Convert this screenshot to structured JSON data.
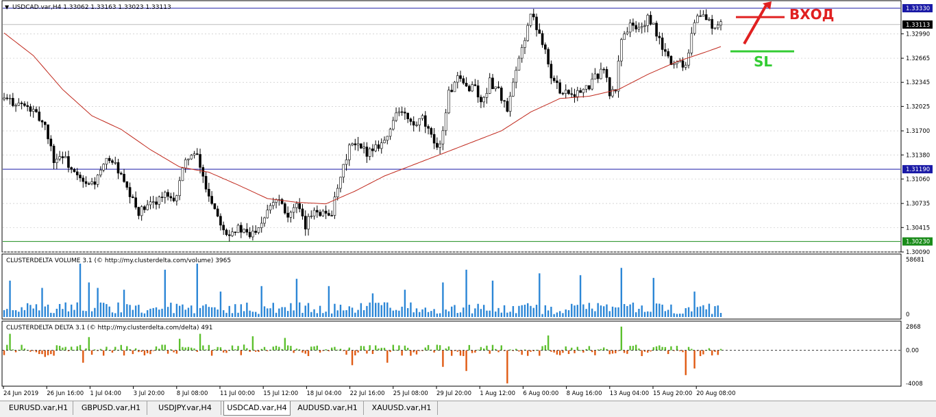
{
  "window": {
    "symbol_info": "USDCAD.var,H4  1.33062 1.33163 1.33023 1.33113",
    "volume_indicator": "CLUSTERDELTA VOLUME 3.1 (© http://my.clusterdelta.com/volume) 3965",
    "delta_indicator": "CLUSTERDELTA DELTA 3.1 (© http://my.clusterdelta.com/delta) 491"
  },
  "annotations": {
    "entry_label": "ВХОД",
    "sl_label": "SL",
    "entry_color": "#e02020",
    "sl_color": "#33cc33"
  },
  "tabs": [
    {
      "label": "EURUSD.var,H1",
      "active": false
    },
    {
      "label": "GBPUSD.var,H1",
      "active": false
    },
    {
      "label": "USDJPY.var,H4",
      "active": false
    },
    {
      "label": "USDCAD.var,H4",
      "active": true
    },
    {
      "label": "AUDUSD.var,H1",
      "active": false
    },
    {
      "label": "XAUUSD.var,H1",
      "active": false
    }
  ],
  "chart_data": [
    {
      "type": "candlestick",
      "title": "USDCAD.var,H4  1.33062 1.33163 1.33023 1.33113",
      "ylim": [
        1.3009,
        1.3343
      ],
      "y_ticks": [
        "1.33330",
        "1.33113",
        "1.32990",
        "1.32665",
        "1.32345",
        "1.32025",
        "1.31700",
        "1.31380",
        "1.31190",
        "1.31060",
        "1.30735",
        "1.30415",
        "1.30230",
        "1.30090"
      ],
      "highlighted_levels": [
        {
          "label": "1.33330",
          "value": 1.3333,
          "color": "#1a1aa6"
        },
        {
          "label": "1.31190",
          "value": 1.3119,
          "color": "#1a1aa6"
        },
        {
          "label": "1.30230",
          "value": 1.3023,
          "color": "#1a8c1a"
        }
      ],
      "current_price_label": "1.33113",
      "current_price": 1.33113,
      "x_tick_labels": [
        "24 Jun 2019",
        "26 Jun 16:00",
        "1 Jul 04:00",
        "3 Jul 20:00",
        "8 Jul 08:00",
        "11 Jul 00:00",
        "15 Jul 12:00",
        "18 Jul 04:00",
        "22 Jul 16:00",
        "25 Jul 08:00",
        "29 Jul 20:00",
        "1 Aug 12:00",
        "6 Aug 00:00",
        "8 Aug 16:00",
        "13 Aug 04:00",
        "15 Aug 20:00",
        "20 Aug 08:00"
      ],
      "close_path": [
        {
          "t": 0,
          "c": 1.3212
        },
        {
          "t": 6,
          "c": 1.3205
        },
        {
          "t": 10,
          "c": 1.3195
        },
        {
          "t": 14,
          "c": 1.3178
        },
        {
          "t": 17,
          "c": 1.3132
        },
        {
          "t": 20,
          "c": 1.3138
        },
        {
          "t": 24,
          "c": 1.3112
        },
        {
          "t": 28,
          "c": 1.3097
        },
        {
          "t": 31,
          "c": 1.3102
        },
        {
          "t": 34,
          "c": 1.3122
        },
        {
          "t": 36,
          "c": 1.3135
        },
        {
          "t": 39,
          "c": 1.3118
        },
        {
          "t": 42,
          "c": 1.309
        },
        {
          "t": 46,
          "c": 1.3062
        },
        {
          "t": 49,
          "c": 1.3068
        },
        {
          "t": 52,
          "c": 1.3078
        },
        {
          "t": 55,
          "c": 1.3085
        },
        {
          "t": 58,
          "c": 1.3072
        },
        {
          "t": 60,
          "c": 1.3105
        },
        {
          "t": 63,
          "c": 1.3138
        },
        {
          "t": 66,
          "c": 1.3135
        },
        {
          "t": 69,
          "c": 1.3095
        },
        {
          "t": 73,
          "c": 1.3058
        },
        {
          "t": 76,
          "c": 1.3035
        },
        {
          "t": 80,
          "c": 1.304
        },
        {
          "t": 84,
          "c": 1.303
        },
        {
          "t": 88,
          "c": 1.305
        },
        {
          "t": 91,
          "c": 1.3075
        },
        {
          "t": 94,
          "c": 1.3082
        },
        {
          "t": 97,
          "c": 1.3058
        },
        {
          "t": 100,
          "c": 1.307
        },
        {
          "t": 103,
          "c": 1.3042
        },
        {
          "t": 106,
          "c": 1.3068
        },
        {
          "t": 109,
          "c": 1.306
        },
        {
          "t": 112,
          "c": 1.3062
        },
        {
          "t": 115,
          "c": 1.3105
        },
        {
          "t": 118,
          "c": 1.315
        },
        {
          "t": 121,
          "c": 1.3148
        },
        {
          "t": 124,
          "c": 1.3142
        },
        {
          "t": 127,
          "c": 1.315
        },
        {
          "t": 131,
          "c": 1.316
        },
        {
          "t": 134,
          "c": 1.3198
        },
        {
          "t": 137,
          "c": 1.319
        },
        {
          "t": 140,
          "c": 1.3175
        },
        {
          "t": 143,
          "c": 1.3185
        },
        {
          "t": 146,
          "c": 1.316
        },
        {
          "t": 149,
          "c": 1.315
        },
        {
          "t": 152,
          "c": 1.322
        },
        {
          "t": 155,
          "c": 1.3238
        },
        {
          "t": 158,
          "c": 1.3228
        },
        {
          "t": 161,
          "c": 1.323
        },
        {
          "t": 163,
          "c": 1.3205
        },
        {
          "t": 166,
          "c": 1.3235
        },
        {
          "t": 169,
          "c": 1.3225
        },
        {
          "t": 172,
          "c": 1.3195
        },
        {
          "t": 175,
          "c": 1.3248
        },
        {
          "t": 178,
          "c": 1.3295
        },
        {
          "t": 180,
          "c": 1.3325
        },
        {
          "t": 183,
          "c": 1.33
        },
        {
          "t": 185,
          "c": 1.328
        },
        {
          "t": 187,
          "c": 1.324
        },
        {
          "t": 190,
          "c": 1.3225
        },
        {
          "t": 193,
          "c": 1.3222
        },
        {
          "t": 196,
          "c": 1.322
        },
        {
          "t": 199,
          "c": 1.3225
        },
        {
          "t": 202,
          "c": 1.324
        },
        {
          "t": 205,
          "c": 1.3255
        },
        {
          "t": 207,
          "c": 1.3218
        },
        {
          "t": 209,
          "c": 1.3225
        },
        {
          "t": 211,
          "c": 1.3295
        },
        {
          "t": 214,
          "c": 1.331
        },
        {
          "t": 217,
          "c": 1.3305
        },
        {
          "t": 220,
          "c": 1.3318
        },
        {
          "t": 222,
          "c": 1.3308
        },
        {
          "t": 225,
          "c": 1.328
        },
        {
          "t": 228,
          "c": 1.326
        },
        {
          "t": 231,
          "c": 1.3262
        },
        {
          "t": 233,
          "c": 1.3258
        },
        {
          "t": 235,
          "c": 1.33
        },
        {
          "t": 237,
          "c": 1.3325
        },
        {
          "t": 240,
          "c": 1.332
        },
        {
          "t": 243,
          "c": 1.3305
        },
        {
          "t": 245,
          "c": 1.3311
        }
      ],
      "moving_average": [
        {
          "t": 0,
          "v": 1.33
        },
        {
          "t": 10,
          "v": 1.327
        },
        {
          "t": 20,
          "v": 1.3225
        },
        {
          "t": 30,
          "v": 1.319
        },
        {
          "t": 40,
          "v": 1.3172
        },
        {
          "t": 50,
          "v": 1.3145
        },
        {
          "t": 60,
          "v": 1.3122
        },
        {
          "t": 70,
          "v": 1.3115
        },
        {
          "t": 80,
          "v": 1.3098
        },
        {
          "t": 90,
          "v": 1.308
        },
        {
          "t": 100,
          "v": 1.3075
        },
        {
          "t": 110,
          "v": 1.3073
        },
        {
          "t": 120,
          "v": 1.309
        },
        {
          "t": 130,
          "v": 1.311
        },
        {
          "t": 140,
          "v": 1.3125
        },
        {
          "t": 150,
          "v": 1.314
        },
        {
          "t": 160,
          "v": 1.3155
        },
        {
          "t": 170,
          "v": 1.317
        },
        {
          "t": 180,
          "v": 1.3195
        },
        {
          "t": 190,
          "v": 1.3213
        },
        {
          "t": 200,
          "v": 1.3216
        },
        {
          "t": 210,
          "v": 1.3225
        },
        {
          "t": 220,
          "v": 1.3245
        },
        {
          "t": 230,
          "v": 1.3262
        },
        {
          "t": 240,
          "v": 1.3275
        },
        {
          "t": 245,
          "v": 1.3282
        }
      ],
      "bars": 246
    },
    {
      "type": "bar",
      "title": "CLUSTERDELTA VOLUME 3.1 (© http://my.clusterdelta.com/volume) 3965",
      "ylim": [
        0,
        58681
      ],
      "y_ticks": [
        "58681",
        "0"
      ],
      "color": "#2b86d6",
      "spikes": [
        {
          "t": 2,
          "v": 40000
        },
        {
          "t": 13,
          "v": 32000
        },
        {
          "t": 26,
          "v": 58681
        },
        {
          "t": 29,
          "v": 38000
        },
        {
          "t": 32,
          "v": 32000
        },
        {
          "t": 41,
          "v": 30000
        },
        {
          "t": 55,
          "v": 52000
        },
        {
          "t": 66,
          "v": 58681
        },
        {
          "t": 74,
          "v": 28000
        },
        {
          "t": 88,
          "v": 34000
        },
        {
          "t": 100,
          "v": 42000
        },
        {
          "t": 111,
          "v": 34000
        },
        {
          "t": 126,
          "v": 26000
        },
        {
          "t": 137,
          "v": 30000
        },
        {
          "t": 150,
          "v": 38000
        },
        {
          "t": 158,
          "v": 52000
        },
        {
          "t": 167,
          "v": 40000
        },
        {
          "t": 183,
          "v": 48000
        },
        {
          "t": 197,
          "v": 46000
        },
        {
          "t": 211,
          "v": 54000
        },
        {
          "t": 222,
          "v": 43000
        },
        {
          "t": 236,
          "v": 28000
        }
      ],
      "base_volume": 13000
    },
    {
      "type": "bar",
      "title": "CLUSTERDELTA DELTA 3.1 (© http://my.clusterdelta.com/delta) 491",
      "ylim": [
        -4008,
        2868
      ],
      "y_ticks": [
        "2868",
        "0.00",
        "-4008"
      ],
      "positive_color": "#5cc02e",
      "negative_color": "#e05a12",
      "spikes": [
        {
          "t": 2,
          "v": 2000
        },
        {
          "t": 14,
          "v": -800
        },
        {
          "t": 27,
          "v": -1500
        },
        {
          "t": 29,
          "v": 1600
        },
        {
          "t": 60,
          "v": 1400
        },
        {
          "t": 67,
          "v": 2000
        },
        {
          "t": 85,
          "v": 1700
        },
        {
          "t": 96,
          "v": 1500
        },
        {
          "t": 119,
          "v": -1800
        },
        {
          "t": 131,
          "v": -1500
        },
        {
          "t": 150,
          "v": -2000
        },
        {
          "t": 158,
          "v": -2500
        },
        {
          "t": 172,
          "v": -4000
        },
        {
          "t": 186,
          "v": 1800
        },
        {
          "t": 211,
          "v": 2868
        },
        {
          "t": 233,
          "v": -3000
        },
        {
          "t": 236,
          "v": -2200
        }
      ]
    }
  ]
}
